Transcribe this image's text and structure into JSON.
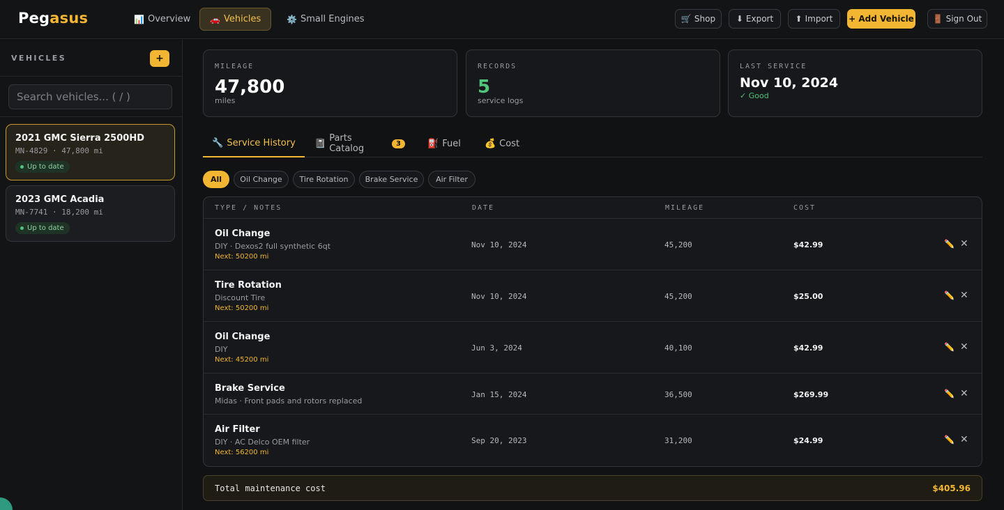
{
  "app": {
    "logo_main": "Peg",
    "logo_accent": "asus"
  },
  "nav": [
    {
      "icon": "📊",
      "label": "Overview"
    },
    {
      "icon": "🚗",
      "label": "Vehicles"
    },
    {
      "icon": "⚙️",
      "label": "Small Engines"
    }
  ],
  "toolbar": {
    "shop": {
      "icon": "🛒",
      "label": "Shop"
    },
    "export": {
      "icon": "⬇",
      "label": "Export"
    },
    "import": {
      "icon": "⬆",
      "label": "Import"
    },
    "add_vehicle": "+ Add Vehicle",
    "sign_out": {
      "icon": "🚪",
      "label": "Sign Out"
    }
  },
  "sidebar": {
    "title": "VEHICLES",
    "add_label": "+",
    "search_placeholder": "Search vehicles... ( / )",
    "vehicles": [
      {
        "name": "2021 GMC Sierra 2500HD",
        "meta": "MN-4829 · 47,800 mi",
        "status": "Up to date"
      },
      {
        "name": "2023 GMC Acadia",
        "meta": "MN-7741 · 18,200 mi",
        "status": "Up to date"
      }
    ]
  },
  "stats": {
    "mileage": {
      "label": "MILEAGE",
      "value": "47,800",
      "sub": "miles"
    },
    "records": {
      "label": "RECORDS",
      "value": "5",
      "sub": "service logs"
    },
    "last_service": {
      "label": "LAST SERVICE",
      "value": "Nov 10, 2024",
      "sub": "✓ Good"
    }
  },
  "tabs": [
    {
      "icon": "🔧",
      "label": "Service History"
    },
    {
      "icon": "📓",
      "label": "Parts Catalog",
      "count": "3"
    },
    {
      "icon": "⛽",
      "label": "Fuel"
    },
    {
      "icon": "💰",
      "label": "Cost"
    }
  ],
  "filters": [
    "All",
    "Oil Change",
    "Tire Rotation",
    "Brake Service",
    "Air Filter"
  ],
  "table": {
    "headers": [
      "TYPE / NOTES",
      "DATE",
      "MILEAGE",
      "COST"
    ],
    "rows": [
      {
        "type": "Oil Change",
        "notes": "DIY · Dexos2 full synthetic 6qt",
        "next": "Next: 50200 mi",
        "date": "Nov 10, 2024",
        "mileage": "45,200",
        "cost": "$42.99"
      },
      {
        "type": "Tire Rotation",
        "notes": "Discount Tire",
        "next": "Next: 50200 mi",
        "date": "Nov 10, 2024",
        "mileage": "45,200",
        "cost": "$25.00"
      },
      {
        "type": "Oil Change",
        "notes": "DIY",
        "next": "Next: 45200 mi",
        "date": "Jun 3, 2024",
        "mileage": "40,100",
        "cost": "$42.99"
      },
      {
        "type": "Brake Service",
        "notes": "Midas · Front pads and rotors replaced",
        "next": "",
        "date": "Jan 15, 2024",
        "mileage": "36,500",
        "cost": "$269.99"
      },
      {
        "type": "Air Filter",
        "notes": "DIY · AC Delco OEM filter",
        "next": "Next: 56200 mi",
        "date": "Sep 20, 2023",
        "mileage": "31,200",
        "cost": "$24.99"
      }
    ],
    "edit_icon": "✏️",
    "delete_icon": "✕"
  },
  "total": {
    "label": "Total maintenance cost",
    "value": "$405.96"
  },
  "colors": {
    "accent": "#f2b632",
    "good": "#4fc47a",
    "background": "#111214"
  }
}
